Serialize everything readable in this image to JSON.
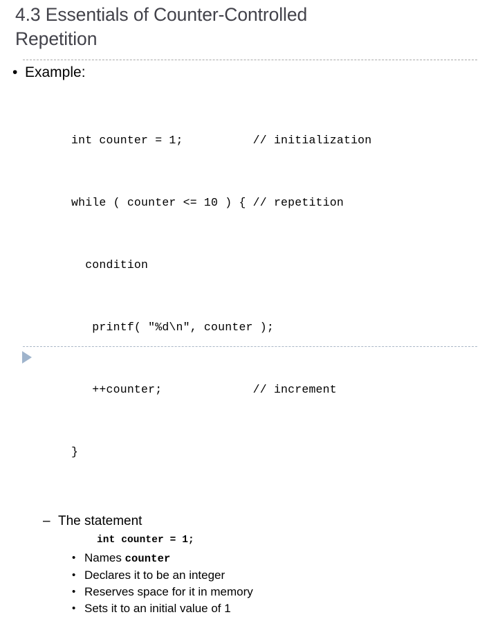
{
  "slide": {
    "title": "4.3  Essentials of Counter-Controlled\nRepetition",
    "title_color": "#42424a",
    "background_color": "#ffffff",
    "body_text_color": "#000000"
  },
  "separators": {
    "top_rule_color": "#a8a8a8",
    "bottom_rule_color": "#a9b6c6",
    "style": "dashed"
  },
  "content": {
    "example": {
      "bullet": "•",
      "label": "Example:"
    },
    "code": {
      "line1": "int counter = 1;          // initialization",
      "line2": "while ( counter <= 10 ) { // repetition",
      "line3": "  condition",
      "line4": "   printf( \"%d\\n\", counter );",
      "line5": "   ++counter;             // increment",
      "line6": "}"
    },
    "statement": {
      "bullet": "–",
      "label": "The statement",
      "code": "int counter = 1;",
      "sub_bullets": [
        {
          "bullet": "•",
          "prefix": "Names ",
          "code": "counter",
          "suffix": ""
        },
        {
          "bullet": "•",
          "prefix": "Declares it to be an integer",
          "code": "",
          "suffix": ""
        },
        {
          "bullet": "•",
          "prefix": "Reserves space for it in memory",
          "code": "",
          "suffix": ""
        },
        {
          "bullet": "•",
          "prefix": "Sets it to an initial value of 1",
          "code": "",
          "suffix": ""
        }
      ]
    }
  },
  "navigation": {
    "next_icon": "play-triangle-icon",
    "next_icon_color": "#9fb4cc"
  }
}
